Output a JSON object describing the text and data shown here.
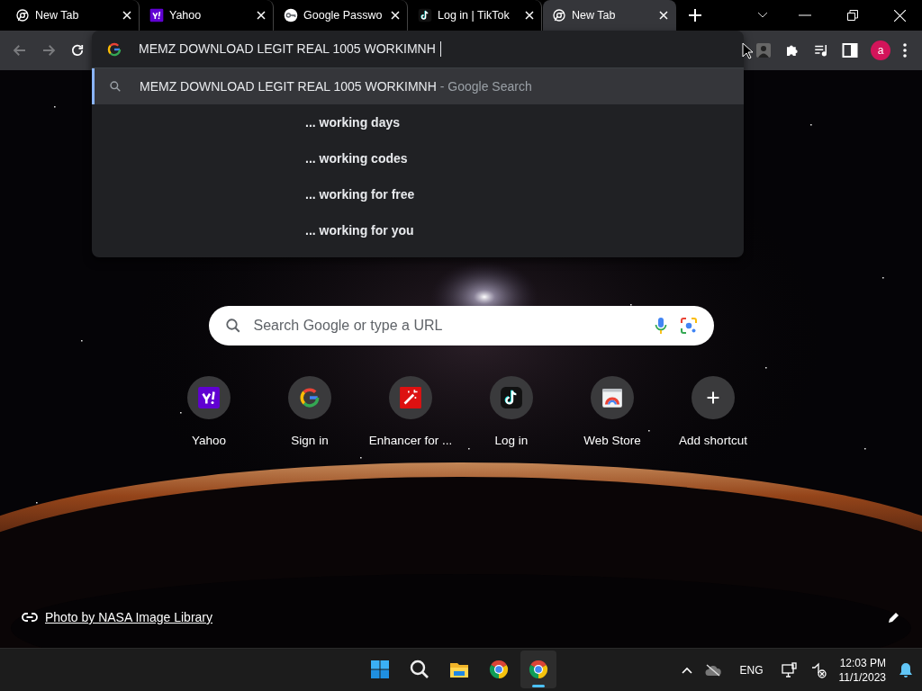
{
  "tabs": [
    {
      "title": "New Tab",
      "selected": false
    },
    {
      "title": "Yahoo",
      "selected": false
    },
    {
      "title": "Google Passwo",
      "selected": false
    },
    {
      "title": "Log in | TikTok",
      "selected": false
    },
    {
      "title": "New Tab",
      "selected": true
    }
  ],
  "nav": [
    {
      "kind": "back",
      "disabled": true
    },
    {
      "kind": "forward",
      "disabled": true
    },
    {
      "kind": "reload",
      "disabled": false
    }
  ],
  "omnibox": {
    "value": "MEMZ DOWNLOAD LEGIT REAL 1005 WORKIMNH ",
    "suggestions": [
      {
        "kind": "search",
        "text": "MEMZ DOWNLOAD LEGIT REAL 1005 WORKIMNH",
        "suffix": "- Google Search",
        "selected": true
      },
      {
        "kind": "tail",
        "text": "... working days",
        "selected": false
      },
      {
        "kind": "tail",
        "text": "... working codes",
        "selected": false
      },
      {
        "kind": "tail",
        "text": "... working for free",
        "selected": false
      },
      {
        "kind": "tail",
        "text": "... working for you",
        "selected": false
      }
    ]
  },
  "profile": {
    "initial": "a"
  },
  "search_box": {
    "placeholder": "Search Google or type a URL"
  },
  "shortcuts": [
    {
      "title": "Yahoo"
    },
    {
      "title": "Sign in"
    },
    {
      "title": "Enhancer for ..."
    },
    {
      "title": "Log in"
    },
    {
      "title": "Web Store"
    },
    {
      "title": "Add shortcut"
    }
  ],
  "photo_credit": "Photo by NASA Image Library",
  "taskbar": {
    "apps": [
      {
        "active": false
      },
      {
        "active": false
      },
      {
        "active": false
      },
      {
        "active": false
      },
      {
        "active": true
      }
    ],
    "language": "ENG",
    "time": "12:03 PM",
    "date": "11/1/2023"
  }
}
